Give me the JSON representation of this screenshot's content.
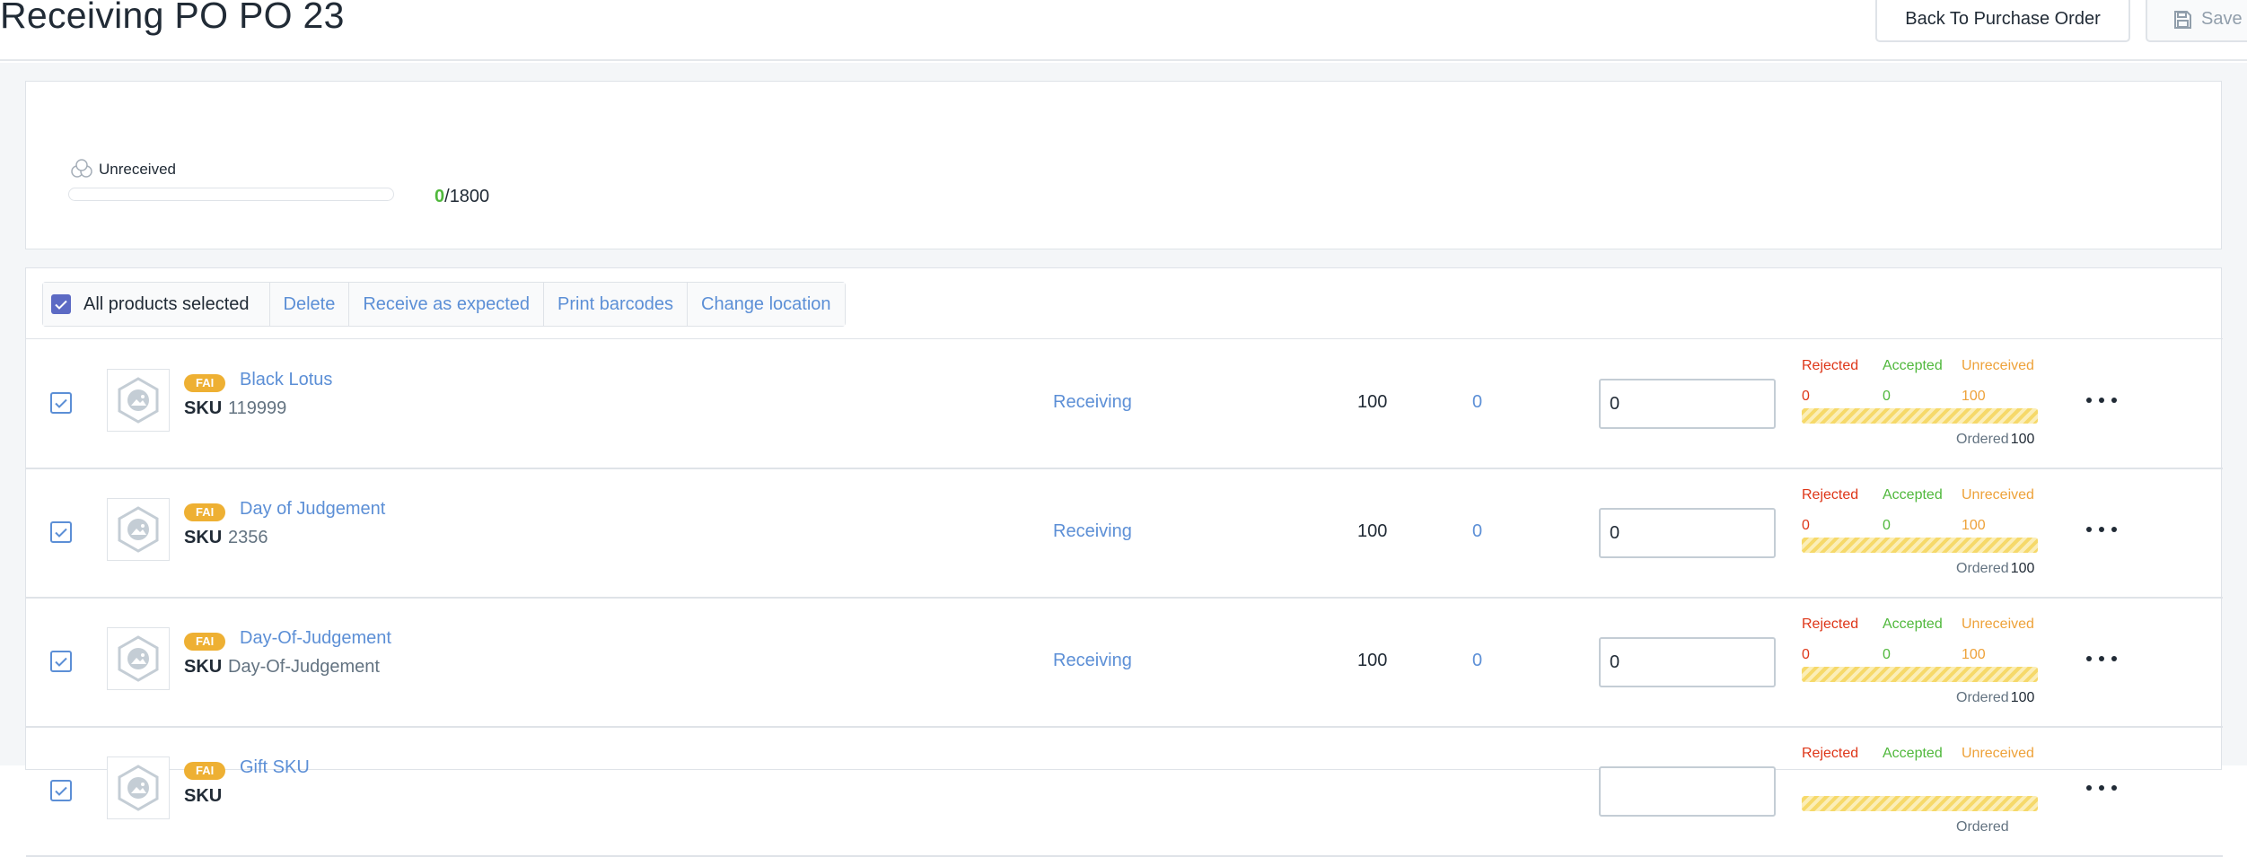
{
  "header": {
    "title": "Receiving PO PO 23",
    "back_button": "Back To Purchase Order",
    "save_button": "Save",
    "save_icon": "floppy-disk-icon"
  },
  "summary": {
    "status_icon": "boxes-icon",
    "status_label": "Unreceived",
    "received": "0",
    "total": "1800",
    "progress": 0,
    "colors": {
      "received": "#50b83c"
    }
  },
  "bulk_actions": {
    "selection_label": "All products selected",
    "delete": "Delete",
    "receive_expected": "Receive as expected",
    "print_barcodes": "Print barcodes",
    "change_location": "Change location"
  },
  "labels": {
    "sku": "SKU",
    "rejected": "Rejected",
    "accepted": "Accepted",
    "unreceived": "Unreceived",
    "ordered": "Ordered"
  },
  "colors": {
    "link": "#5c8fd6",
    "badge": "#eeb033",
    "rejected": "#de3618",
    "accepted": "#50b83c",
    "unreceived": "#eea23a"
  },
  "rows": [
    {
      "checked": true,
      "badge": "FAI",
      "name": "Black Lotus",
      "sku": "119999",
      "status": "Receiving",
      "expected": "100",
      "received": "0",
      "input_value": "0",
      "rejected": "0",
      "accepted": "0",
      "unreceived": "100",
      "ordered": "100"
    },
    {
      "checked": true,
      "badge": "FAI",
      "name": "Day of Judgement",
      "sku": "2356",
      "status": "Receiving",
      "expected": "100",
      "received": "0",
      "input_value": "0",
      "rejected": "0",
      "accepted": "0",
      "unreceived": "100",
      "ordered": "100"
    },
    {
      "checked": true,
      "badge": "FAI",
      "name": "Day-Of-Judgement",
      "sku": "Day-Of-Judgement",
      "status": "Receiving",
      "expected": "100",
      "received": "0",
      "input_value": "0",
      "rejected": "0",
      "accepted": "0",
      "unreceived": "100",
      "ordered": "100"
    },
    {
      "checked": true,
      "badge": "FAI",
      "name": "Gift SKU",
      "sku": "",
      "status": "",
      "expected": "",
      "received": "",
      "input_value": "",
      "rejected": "",
      "accepted": "",
      "unreceived": "",
      "ordered": ""
    }
  ]
}
